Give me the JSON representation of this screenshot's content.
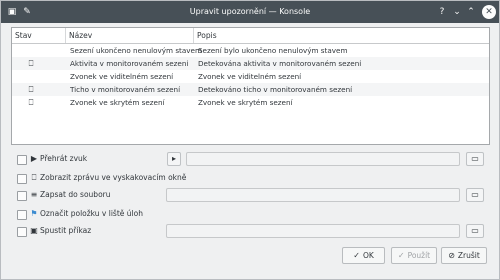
{
  "window": {
    "title": "Upravit upozornění — Konsole",
    "app_icon": "konsole-icon",
    "pin_icon": "pin-icon",
    "help_label": "?",
    "minimize_label": "⌄",
    "maximize_label": "⌃",
    "close_label": "✕"
  },
  "table": {
    "headers": [
      "Stav",
      "Název",
      "Popis"
    ],
    "rows": [
      {
        "icon": "",
        "name": "Sezení ukončeno nenulovým stavem",
        "description": "Sezení bylo ukončeno nenulovým stavem"
      },
      {
        "icon": "popup-icon",
        "name": "Aktivita v monitorovaném sezení",
        "description": "Detekována aktivita v monitorovaném sezení"
      },
      {
        "icon": "",
        "name": "Zvonek ve viditelném sezení",
        "description": "Zvonek ve viditelném sezení"
      },
      {
        "icon": "popup-icon",
        "name": "Ticho v monitorovaném sezení",
        "description": "Detekováno ticho v monitorovaném sezení"
      },
      {
        "icon": "popup-icon",
        "name": "Zvonek ve skrytém sezení",
        "description": "Zvonek ve skrytém sezení"
      }
    ]
  },
  "options": {
    "play_sound": {
      "label": "Přehrát  zvuk",
      "checked": false,
      "icon": "play-icon"
    },
    "show_popup": {
      "label": "Zobrazit zprávu ve vyskakovacím okně",
      "checked": false,
      "icon": "popup-icon"
    },
    "log_file": {
      "label": "Zapsat do souboru",
      "checked": false,
      "icon": "document-icon"
    },
    "mark_taskbar": {
      "label": "Označit položku v liště úloh",
      "checked": false,
      "icon": "flag-icon"
    },
    "run_command": {
      "label": "Spustit příkaz",
      "checked": false,
      "icon": "terminal-icon"
    }
  },
  "buttons": {
    "ok": "OK",
    "apply": "Použít",
    "cancel": "Zrušit"
  }
}
